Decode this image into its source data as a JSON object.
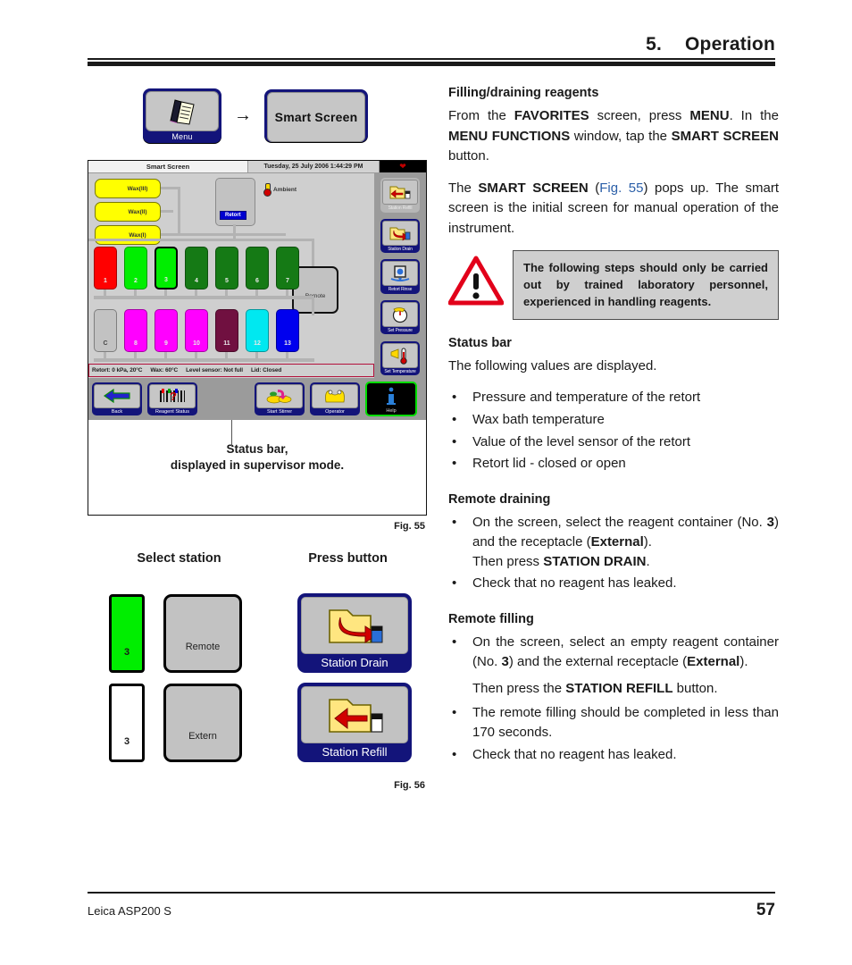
{
  "header": {
    "chapter_number": "5.",
    "chapter_title": "Operation"
  },
  "footer": {
    "product": "Leica ASP200 S",
    "page_number": "57"
  },
  "flow_buttons": {
    "menu_label": "Menu",
    "smart_screen_label": "Smart Screen",
    "arrow": "→"
  },
  "fig55": {
    "label": "Fig. 55",
    "caption_line1": "Status bar,",
    "caption_line2": "displayed in supervisor mode."
  },
  "smart_screen": {
    "title": "Smart Screen",
    "datetime": "Tuesday, 25 July 2006 1:44:29 PM",
    "heart_icon": "heart-icon",
    "wax_stations": [
      {
        "label": "Wax(III)",
        "color": "#ffff00"
      },
      {
        "label": "Wax(II)",
        "color": "#ffff00"
      },
      {
        "label": "Wax(I)",
        "color": "#ffff00"
      }
    ],
    "retort": {
      "tag": "Retort"
    },
    "ambient": {
      "label": "Ambient"
    },
    "remote": {
      "label": "Remote"
    },
    "stations_row1": [
      {
        "id": "1",
        "color": "#ff0000",
        "selected": false
      },
      {
        "id": "2",
        "color": "#00ee00",
        "selected": false
      },
      {
        "id": "3",
        "color": "#00ee00",
        "selected": true
      },
      {
        "id": "4",
        "color": "#157a15",
        "selected": false
      },
      {
        "id": "5",
        "color": "#157a15",
        "selected": false
      },
      {
        "id": "6",
        "color": "#157a15",
        "selected": false
      },
      {
        "id": "7",
        "color": "#157a15",
        "selected": false
      }
    ],
    "stations_row2": [
      {
        "id": "C",
        "color": "#c2c2c2",
        "selected": false,
        "dark": true
      },
      {
        "id": "8",
        "color": "#ff00ff",
        "selected": false
      },
      {
        "id": "9",
        "color": "#ff00ff",
        "selected": false
      },
      {
        "id": "10",
        "color": "#ff00ff",
        "selected": false
      },
      {
        "id": "11",
        "color": "#701040",
        "selected": false
      },
      {
        "id": "12",
        "color": "#00e8f0",
        "selected": false
      },
      {
        "id": "13",
        "color": "#0000ee",
        "selected": false
      }
    ],
    "status_bar": {
      "retort": "Retort:  0 kPa, 20°C",
      "wax": "Wax: 60°C",
      "level_sensor": "Level sensor: Not full",
      "lid": "Lid: Closed",
      "border_color": "#b3113b"
    },
    "sidebar_buttons": [
      {
        "label": "Station Refill",
        "icon": "station-refill-icon",
        "highlighted": false
      },
      {
        "label": "Station Drain",
        "icon": "station-drain-icon",
        "highlighted": true
      },
      {
        "label": "Retort Rinse",
        "icon": "retort-rinse-icon",
        "highlighted": true
      },
      {
        "label": "Set Pressure",
        "icon": "set-pressure-icon",
        "highlighted": true
      },
      {
        "label": "Set Temperature",
        "icon": "set-temperature-icon",
        "highlighted": true
      }
    ],
    "footer_buttons": [
      {
        "label": "Back",
        "icon": "back-arrow-icon"
      },
      {
        "label": "Reagent Status",
        "icon": "reagent-status-icon"
      },
      {
        "label": "Start Stirrer",
        "icon": "start-stirrer-icon"
      },
      {
        "label": "Operator",
        "icon": "operator-icon"
      },
      {
        "label": "Help",
        "icon": "help-info-icon"
      }
    ]
  },
  "fig56": {
    "label": "Fig. 56",
    "head_select": "Select station",
    "head_press": "Press button",
    "row1": {
      "vial_id": "3",
      "vial_color": "#00ee00",
      "pad_label": "Remote",
      "button_label": "Station Drain",
      "button_icon": "station-drain-icon"
    },
    "row2": {
      "vial_id": "3",
      "vial_color": "#ffffff",
      "pad_label": "Extern",
      "button_label": "Station Refill",
      "button_icon": "station-refill-icon"
    }
  },
  "content": {
    "filling_heading": "Filling/draining reagents",
    "para1": {
      "t1": "From the ",
      "b1": "FAVORITES",
      "t2": " screen, press ",
      "b2": "MENU",
      "t3": ". In the ",
      "b3": "MENU FUNCTIONS",
      "t4": " window, tap the ",
      "b4": "SMART SCREEN",
      "t5": " button."
    },
    "para2": {
      "t1": "The ",
      "b1": "SMART SCREEN",
      "t2": " (",
      "ref": "Fig. 55",
      "t3": ") pops up. The smart screen is the initial screen for manual operation of the instrument."
    },
    "warning": {
      "icon": "warning-triangle-icon",
      "text": "The following steps should only be carried out by trained laboratory personnel, experienced in handling reagents."
    },
    "status_bar_heading": "Status bar",
    "status_bar_intro": "The following values are displayed.",
    "status_bar_items": [
      "Pressure and temperature of the retort",
      "Wax bath temperature",
      "Value of the level sensor of the retort",
      "Retort lid - closed or open"
    ],
    "remote_draining_heading": "Remote draining",
    "remote_draining": {
      "b1_t1": "On the screen, select the reagent container (No. ",
      "b1_n": "3",
      "b1_t2": ") and the receptacle (",
      "b1_ext": "External",
      "b1_t3": ").",
      "b1_line2_t1": "Then press ",
      "b1_line2_b": "STATION DRAIN",
      "b1_line2_t2": ".",
      "b2": "Check that no reagent has leaked."
    },
    "remote_filling_heading": "Remote filling",
    "remote_filling": {
      "b1_t1": "On the screen, select an empty reagent container (No. ",
      "b1_n": "3",
      "b1_t2": ") and the external receptacle (",
      "b1_ext": "External",
      "b1_t3": ").",
      "indent_t1": "Then press the ",
      "indent_b": "STATION REFILL",
      "indent_t2": " button.",
      "b2": "The remote filling should be completed in less than 170 seconds.",
      "b3": "Check that no reagent has leaked."
    }
  }
}
